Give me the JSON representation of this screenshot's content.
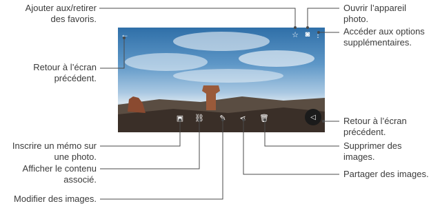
{
  "labels": {
    "favorites": "Ajouter aux/retirer\ndes favoris.",
    "camera": "Ouvrir l’appareil\nphoto.",
    "more_options": "Accéder aux options\nsupplémentaires.",
    "back_top": "Retour à l’écran\nprécédent.",
    "back_bottom": "Retour à l’écran\nprécédent.",
    "memo": "Inscrire un mémo sur\nune photo.",
    "related": "Afficher le contenu\nassocié.",
    "edit": "Modifier des images.",
    "delete": "Supprimer des\nimages.",
    "share": "Partager des images."
  },
  "icons": {
    "back": "back-arrow-icon",
    "star": "star-icon",
    "camera": "camera-icon",
    "more": "more-vert-icon",
    "memo": "memo-icon",
    "related": "link-icon",
    "edit": "pencil-icon",
    "share": "share-icon",
    "delete": "trash-icon",
    "nav_back": "triangle-back-icon"
  }
}
